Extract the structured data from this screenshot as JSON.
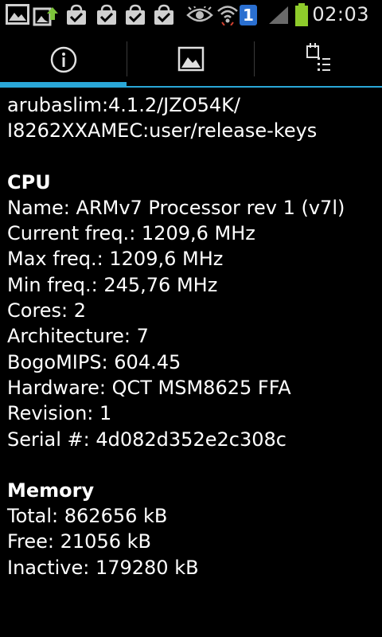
{
  "status_bar": {
    "time": "02:03",
    "notification_badge": "1",
    "icons": [
      "gallery-icon",
      "upload-icon",
      "shopping-bag-check-icon",
      "shopping-bag-check-icon",
      "shopping-bag-check-icon",
      "shopping-bag-check-icon",
      "eye-icon",
      "wifi-icon",
      "notification-count-icon",
      "signal-icon",
      "battery-icon"
    ],
    "battery_color": "#8ecb2b"
  },
  "tabs": [
    {
      "icon": "info-icon",
      "selected": true
    },
    {
      "icon": "image-icon",
      "selected": false
    },
    {
      "icon": "task-list-icon",
      "selected": false
    }
  ],
  "accent_color": "#2aa7d8",
  "content": {
    "build_line1": "arubaslim:4.1.2/JZO54K/",
    "build_line2": "I8262XXAMEC:user/release-keys",
    "cpu": {
      "heading": "CPU",
      "name": "Name: ARMv7 Processor rev 1 (v7l)",
      "current_freq": "Current freq.: 1209,6 MHz",
      "max_freq": "Max freq.: 1209,6 MHz",
      "min_freq": "Min freq.: 245,76 MHz",
      "cores": "Cores: 2",
      "architecture": "Architecture: 7",
      "bogomips": "BogoMIPS: 604.45",
      "hardware": "Hardware: QCT MSM8625 FFA",
      "revision": "Revision: 1",
      "serial": "Serial #: 4d082d352e2c308c"
    },
    "memory": {
      "heading": "Memory",
      "total": "Total: 862656 kB",
      "free": "Free: 21056 kB",
      "inactive": "Inactive: 179280 kB"
    }
  }
}
